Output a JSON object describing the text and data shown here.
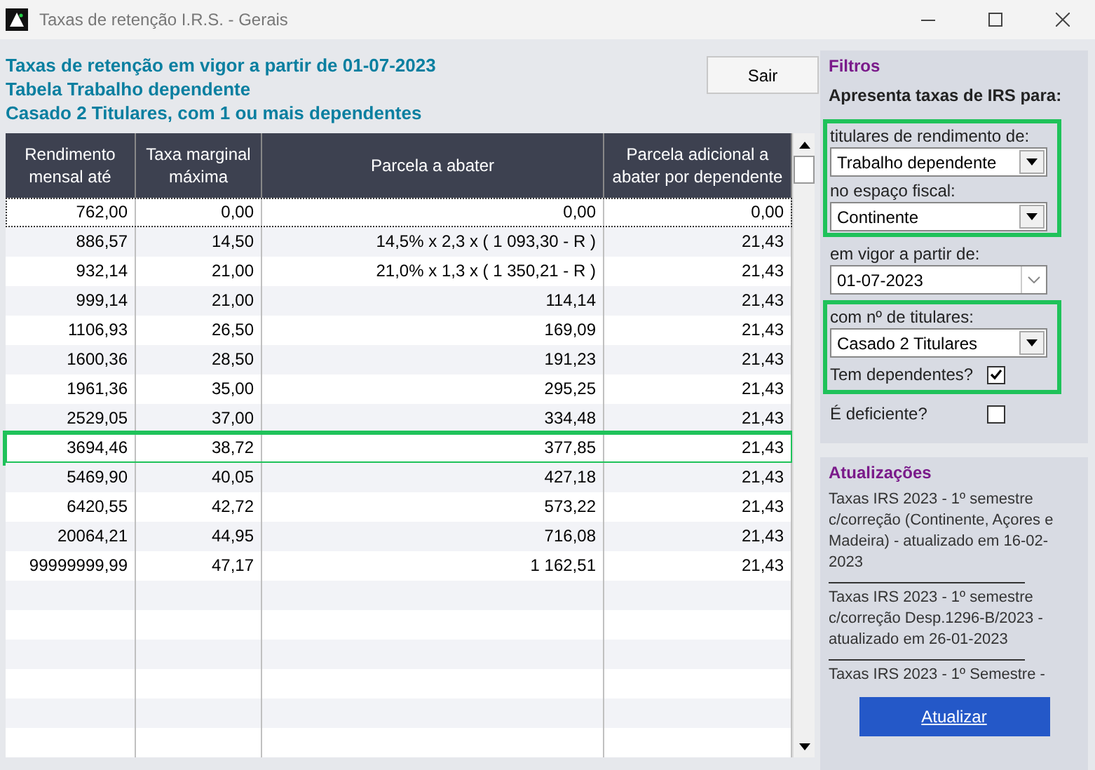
{
  "window": {
    "title": "Taxas de retenção I.R.S. - Gerais"
  },
  "heading": [
    "Taxas de retenção em vigor a partir de 01-07-2023",
    "Tabela Trabalho dependente",
    "Casado 2 Titulares, com 1 ou mais dependentes"
  ],
  "exit_button": "Sair",
  "table": {
    "columns": [
      "Rendimento mensal até",
      "Taxa marginal máxima",
      "Parcela a abater",
      "Parcela adicional a abater por dependente"
    ],
    "rows": [
      {
        "cells": [
          "762,00",
          "0,00",
          "0,00",
          "0,00"
        ],
        "focused": true,
        "highlighted": false
      },
      {
        "cells": [
          "886,57",
          "14,50",
          "14,5% x 2,3 x ( 1 093,30 - R )",
          "21,43"
        ],
        "focused": false,
        "highlighted": false
      },
      {
        "cells": [
          "932,14",
          "21,00",
          "21,0% x 1,3 x ( 1 350,21 - R )",
          "21,43"
        ],
        "focused": false,
        "highlighted": false
      },
      {
        "cells": [
          "999,14",
          "21,00",
          "114,14",
          "21,43"
        ],
        "focused": false,
        "highlighted": false
      },
      {
        "cells": [
          "1106,93",
          "26,50",
          "169,09",
          "21,43"
        ],
        "focused": false,
        "highlighted": false
      },
      {
        "cells": [
          "1600,36",
          "28,50",
          "191,23",
          "21,43"
        ],
        "focused": false,
        "highlighted": false
      },
      {
        "cells": [
          "1961,36",
          "35,00",
          "295,25",
          "21,43"
        ],
        "focused": false,
        "highlighted": false
      },
      {
        "cells": [
          "2529,05",
          "37,00",
          "334,48",
          "21,43"
        ],
        "focused": false,
        "highlighted": false
      },
      {
        "cells": [
          "3694,46",
          "38,72",
          "377,85",
          "21,43"
        ],
        "focused": false,
        "highlighted": true
      },
      {
        "cells": [
          "5469,90",
          "40,05",
          "427,18",
          "21,43"
        ],
        "focused": false,
        "highlighted": false
      },
      {
        "cells": [
          "6420,55",
          "42,72",
          "573,22",
          "21,43"
        ],
        "focused": false,
        "highlighted": false
      },
      {
        "cells": [
          "20064,21",
          "44,95",
          "716,08",
          "21,43"
        ],
        "focused": false,
        "highlighted": false
      },
      {
        "cells": [
          "99999999,99",
          "47,17",
          "1 162,51",
          "21,43"
        ],
        "focused": false,
        "highlighted": false
      }
    ]
  },
  "filters": {
    "title": "Filtros",
    "subtitle": "Apresenta taxas de IRS para:",
    "groups": [
      {
        "highlighted": true,
        "fields": [
          {
            "kind": "combo",
            "label": "titulares de rendimento de:",
            "value": "Trabalho dependente"
          },
          {
            "kind": "combo",
            "label": "no espaço fiscal:",
            "value": "Continente"
          }
        ]
      },
      {
        "highlighted": false,
        "fields": [
          {
            "kind": "date",
            "label": "em vigor a partir de:",
            "value": "01-07-2023"
          }
        ]
      },
      {
        "highlighted": true,
        "fields": [
          {
            "kind": "combo",
            "label": "com nº de titulares:",
            "value": "Casado 2 Titulares"
          },
          {
            "kind": "checkbox",
            "label": "Tem dependentes?",
            "checked": true
          }
        ]
      },
      {
        "highlighted": false,
        "fields": [
          {
            "kind": "checkbox",
            "label": "É deficiente?",
            "checked": false
          }
        ]
      }
    ]
  },
  "updates": {
    "title": "Atualizações",
    "items": [
      "Taxas IRS 2023 - 1º semestre c/correção (Continente, Açores e Madeira) - atualizado em 16-02-2023",
      "Taxas IRS 2023 - 1º semestre c/correção Desp.1296-B/2023 - atualizado em 26-01-2023",
      "Taxas IRS 2023 - 1º Semestre -"
    ],
    "button": "Atualizar"
  }
}
